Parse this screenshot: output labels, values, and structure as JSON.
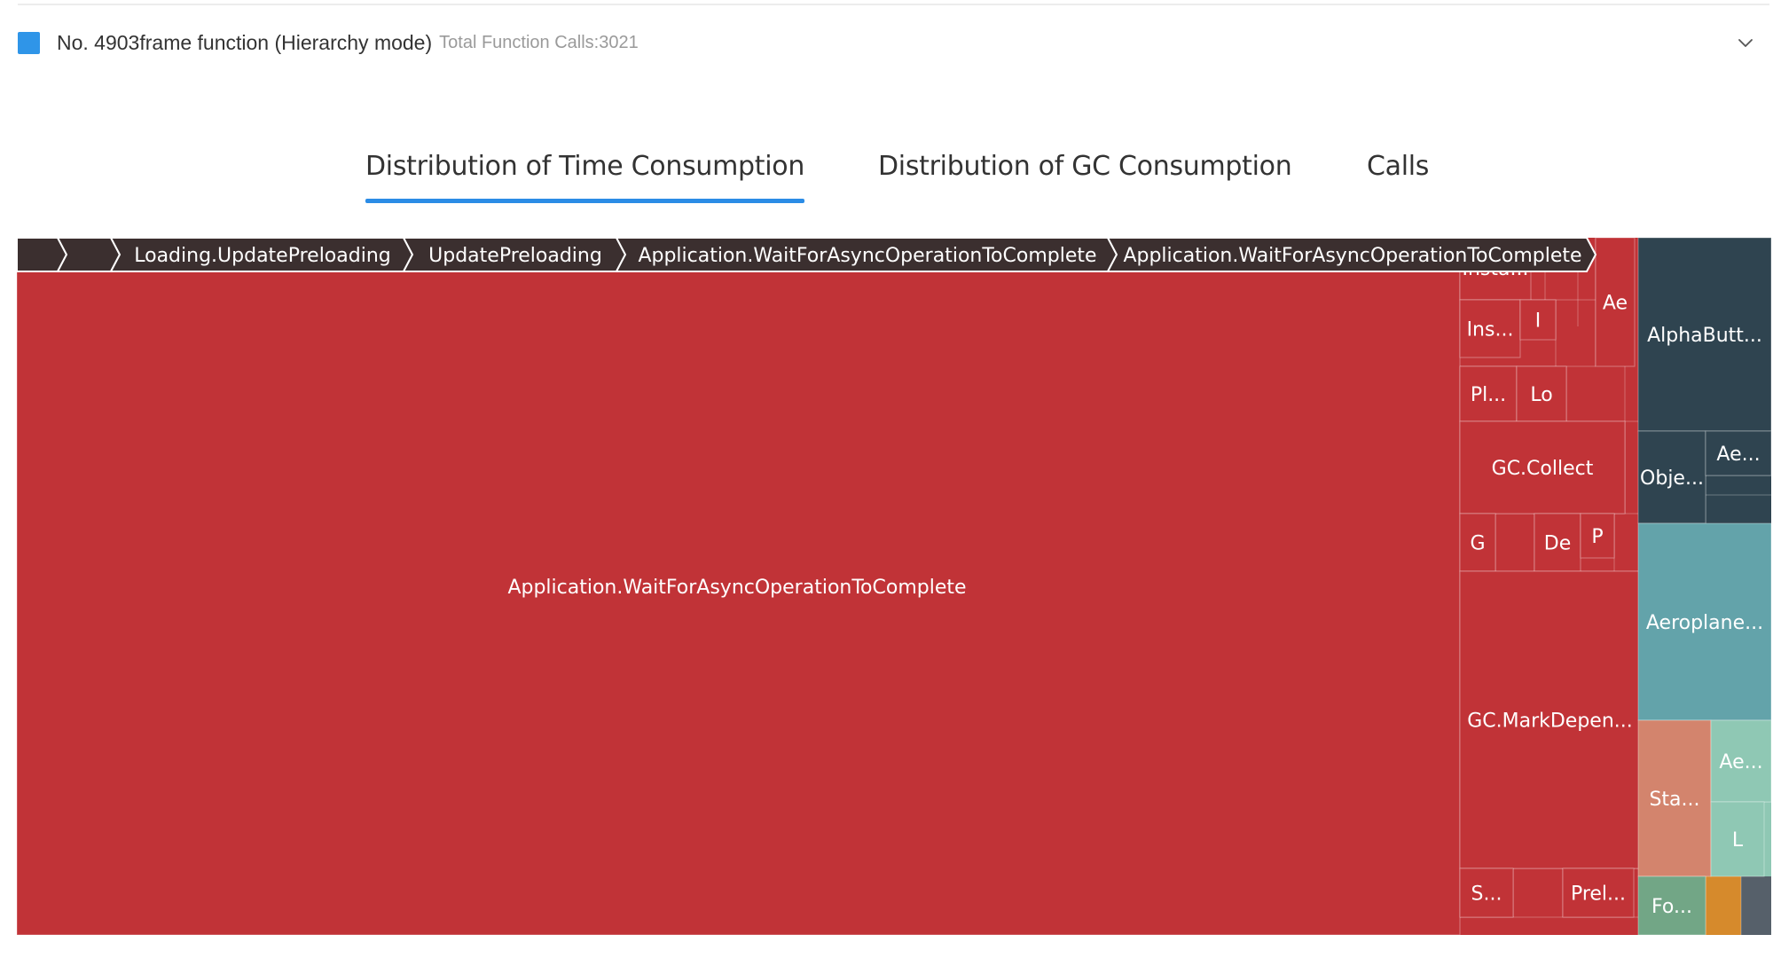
{
  "header": {
    "title": "No. 4903frame function (Hierarchy mode)",
    "subtitle": "Total Function Calls:3021",
    "legend_color": "#2f95e8",
    "expand_icon": "chevron-down-icon"
  },
  "tabs": [
    {
      "label": "Distribution of Time Consumption",
      "active": true
    },
    {
      "label": "Distribution of GC Consumption",
      "active": false
    },
    {
      "label": "Calls",
      "active": false
    }
  ],
  "breadcrumb": {
    "items": [
      "",
      "",
      "Loading.UpdatePreloading",
      "UpdatePreloading",
      "Application.WaitForAsyncOperationToComplete",
      "Application.WaitForAsyncOperationToComplete"
    ]
  },
  "colors": {
    "red": "#c13337",
    "dark_slate": "#2f4450",
    "teal": "#63a3aa",
    "salmon": "#d3846d",
    "mint": "#8fc8b4",
    "sage": "#72a686",
    "orange": "#d68a2c",
    "breadcrumb_bg": "#3b2f2f"
  },
  "chart_data": {
    "type": "treemap",
    "title": "",
    "cells": [
      {
        "label": "Application.WaitForAsyncOperationToComplete",
        "group": "red"
      },
      {
        "label": "Insta...",
        "group": "red"
      },
      {
        "label": "Ae",
        "group": "red"
      },
      {
        "label": "Ins...",
        "group": "red"
      },
      {
        "label": "I",
        "group": "red"
      },
      {
        "label": "Pl...",
        "group": "red"
      },
      {
        "label": "Lo",
        "group": "red"
      },
      {
        "label": "GC.Collect",
        "group": "red"
      },
      {
        "label": "G",
        "group": "red"
      },
      {
        "label": "De",
        "group": "red"
      },
      {
        "label": "P",
        "group": "red"
      },
      {
        "label": "GC.MarkDepen...",
        "group": "red"
      },
      {
        "label": "S...",
        "group": "red"
      },
      {
        "label": "Prel...",
        "group": "red"
      },
      {
        "label": "AlphaButt...",
        "group": "dark_slate"
      },
      {
        "label": "Obje...",
        "group": "dark_slate"
      },
      {
        "label": "Ae...",
        "group": "dark_slate"
      },
      {
        "label": "Aeroplane...",
        "group": "teal"
      },
      {
        "label": "Sta...",
        "group": "salmon"
      },
      {
        "label": "Ae...",
        "group": "mint"
      },
      {
        "label": "L",
        "group": "mint"
      },
      {
        "label": "Fo...",
        "group": "sage"
      }
    ]
  }
}
